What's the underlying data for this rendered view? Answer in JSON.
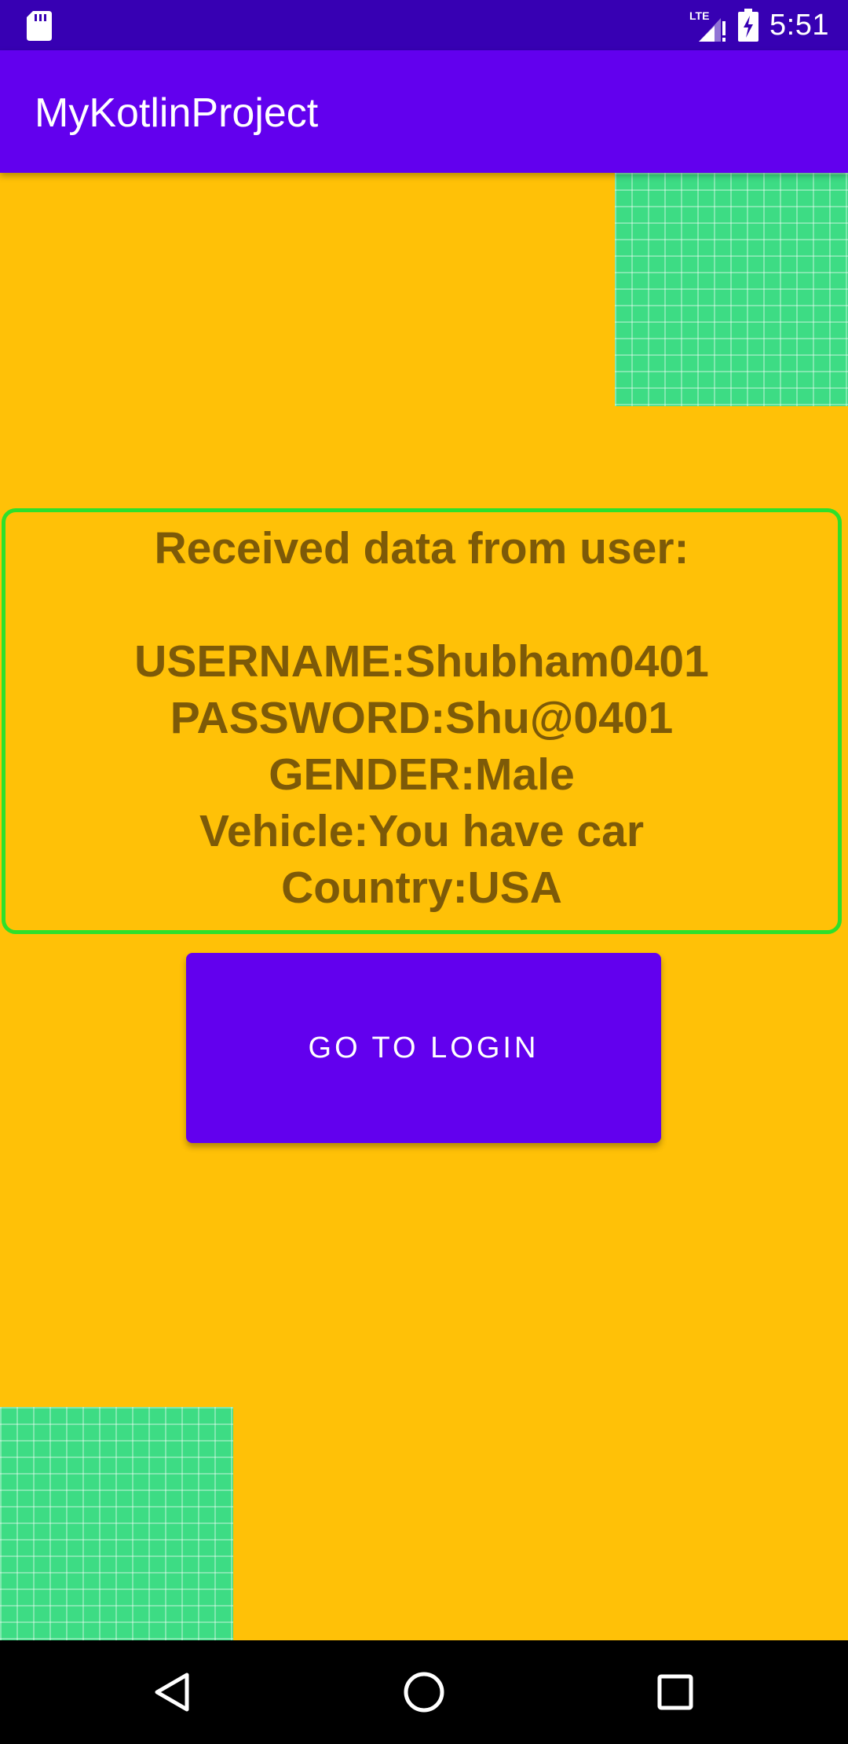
{
  "status_bar": {
    "time": "5:51",
    "network_label": "LTE",
    "icons": [
      "sd-card-icon",
      "lte-signal-icon",
      "battery-charging-icon"
    ]
  },
  "app_bar": {
    "title": "MyKotlinProject"
  },
  "data_card": {
    "heading": "Received data from user:",
    "lines": [
      "USERNAME:Shubham0401",
      "PASSWORD:Shu@0401",
      "GENDER:Male",
      "Vehicle:You have car",
      "Country:USA"
    ],
    "text_color": "#7D5A08",
    "border_color": "#2EE02A"
  },
  "login_button": {
    "label": "GO TO LOGIN"
  },
  "nav_bar": {
    "icons": [
      "back-icon",
      "home-icon",
      "recents-icon"
    ]
  },
  "colors": {
    "status_bar": "#3700B3",
    "app_bar": "#6200EE",
    "background": "#FFC107",
    "decor_grid": "#3DDC84",
    "button": "#6200EE"
  }
}
